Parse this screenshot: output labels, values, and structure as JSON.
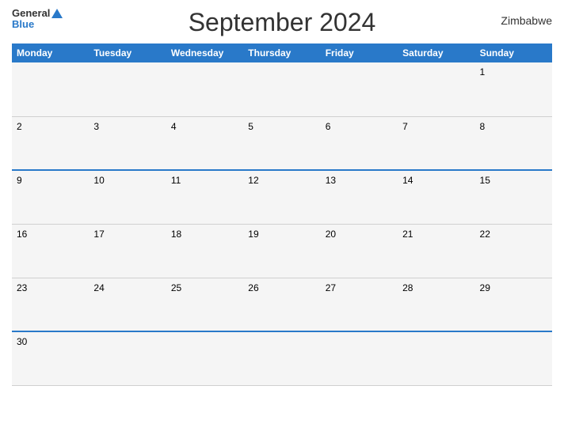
{
  "header": {
    "title": "September 2024",
    "country": "Zimbabwe",
    "logo": {
      "general": "General",
      "blue": "Blue"
    }
  },
  "days": [
    "Monday",
    "Tuesday",
    "Wednesday",
    "Thursday",
    "Friday",
    "Saturday",
    "Sunday"
  ],
  "weeks": [
    {
      "blue_top": false,
      "cells": [
        {
          "num": "",
          "empty": true
        },
        {
          "num": "",
          "empty": true
        },
        {
          "num": "",
          "empty": true
        },
        {
          "num": "",
          "empty": true
        },
        {
          "num": "",
          "empty": true
        },
        {
          "num": "",
          "empty": true
        },
        {
          "num": "1",
          "empty": false
        }
      ]
    },
    {
      "blue_top": false,
      "cells": [
        {
          "num": "2",
          "empty": false
        },
        {
          "num": "3",
          "empty": false
        },
        {
          "num": "4",
          "empty": false
        },
        {
          "num": "5",
          "empty": false
        },
        {
          "num": "6",
          "empty": false
        },
        {
          "num": "7",
          "empty": false
        },
        {
          "num": "8",
          "empty": false
        }
      ]
    },
    {
      "blue_top": true,
      "cells": [
        {
          "num": "9",
          "empty": false
        },
        {
          "num": "10",
          "empty": false
        },
        {
          "num": "11",
          "empty": false
        },
        {
          "num": "12",
          "empty": false
        },
        {
          "num": "13",
          "empty": false
        },
        {
          "num": "14",
          "empty": false
        },
        {
          "num": "15",
          "empty": false
        }
      ]
    },
    {
      "blue_top": false,
      "cells": [
        {
          "num": "16",
          "empty": false
        },
        {
          "num": "17",
          "empty": false
        },
        {
          "num": "18",
          "empty": false
        },
        {
          "num": "19",
          "empty": false
        },
        {
          "num": "20",
          "empty": false
        },
        {
          "num": "21",
          "empty": false
        },
        {
          "num": "22",
          "empty": false
        }
      ]
    },
    {
      "blue_top": false,
      "cells": [
        {
          "num": "23",
          "empty": false
        },
        {
          "num": "24",
          "empty": false
        },
        {
          "num": "25",
          "empty": false
        },
        {
          "num": "26",
          "empty": false
        },
        {
          "num": "27",
          "empty": false
        },
        {
          "num": "28",
          "empty": false
        },
        {
          "num": "29",
          "empty": false
        }
      ]
    },
    {
      "blue_top": true,
      "cells": [
        {
          "num": "30",
          "empty": false
        },
        {
          "num": "",
          "empty": true
        },
        {
          "num": "",
          "empty": true
        },
        {
          "num": "",
          "empty": true
        },
        {
          "num": "",
          "empty": true
        },
        {
          "num": "",
          "empty": true
        },
        {
          "num": "",
          "empty": true
        }
      ]
    }
  ]
}
